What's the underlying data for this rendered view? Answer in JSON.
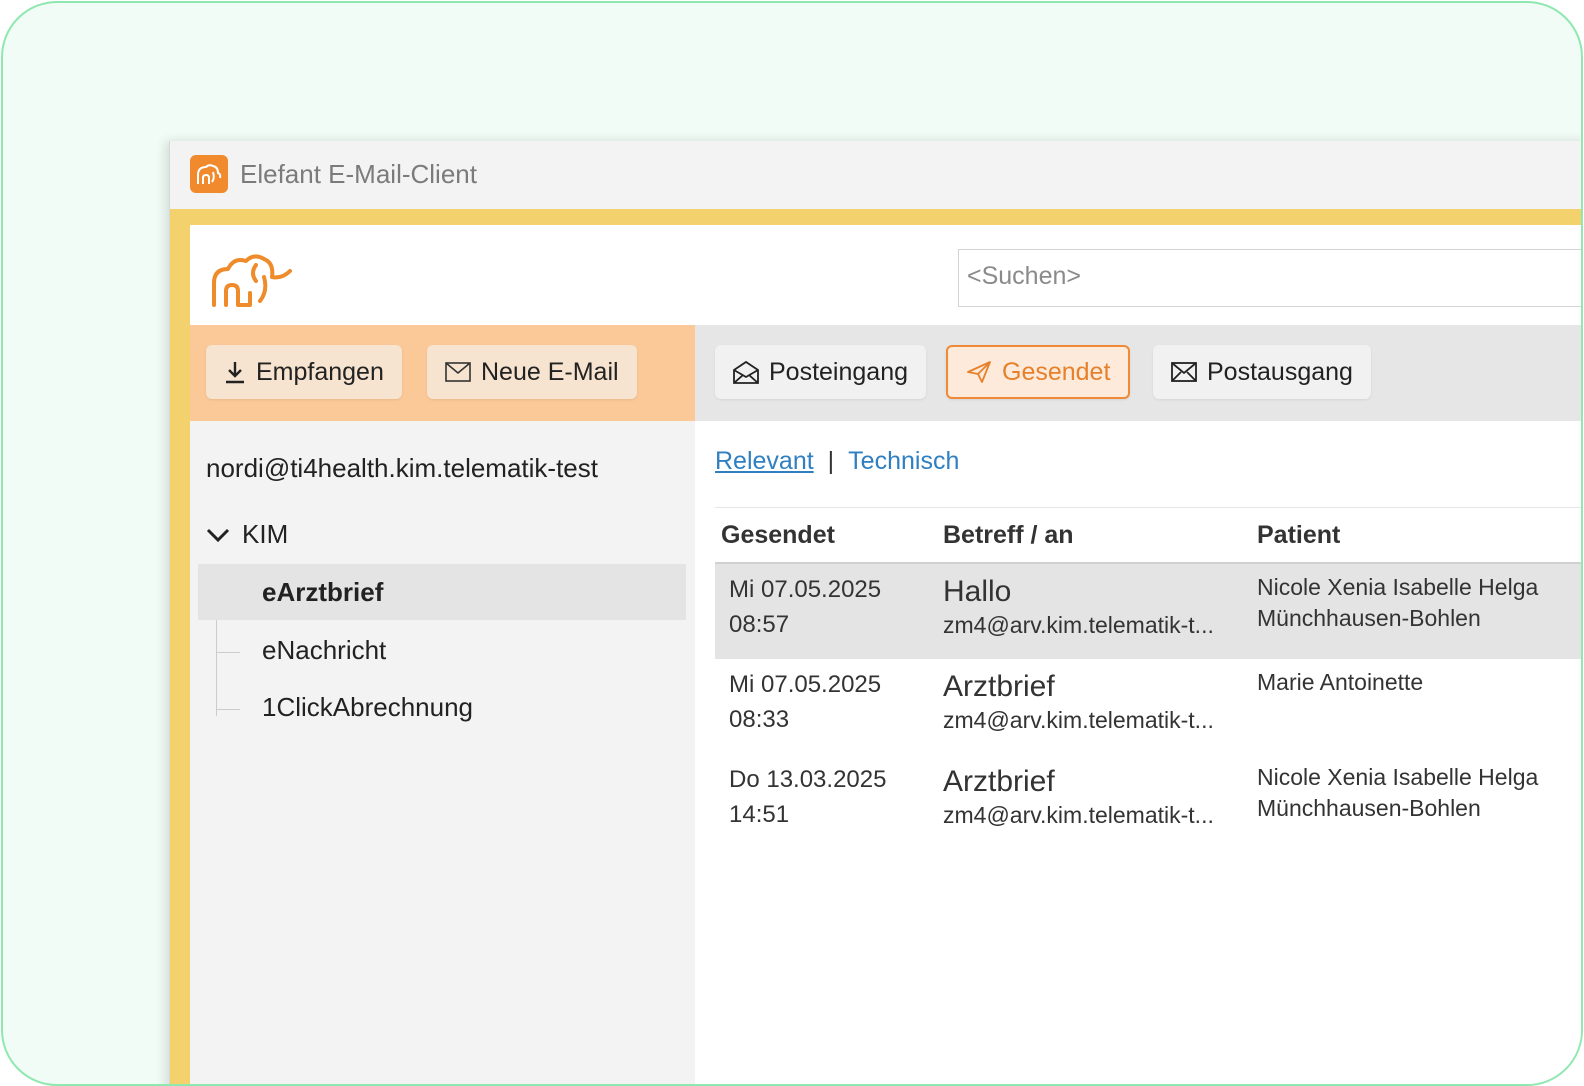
{
  "window": {
    "title": "Elefant E-Mail-Client",
    "app_icon": "elephant-icon",
    "accent_color": "#f08a2c"
  },
  "search": {
    "placeholder": "<Suchen>"
  },
  "toolbar": {
    "receive_label": "Empfangen",
    "new_mail_label": "Neue E-Mail",
    "inbox_label": "Posteingang",
    "sent_label": "Gesendet",
    "outbox_label": "Postausgang"
  },
  "sidebar": {
    "account": "nordi@ti4health.kim.telematik-test",
    "group": "KIM",
    "folders": [
      "eArztbrief",
      "eNachricht",
      "1ClickAbrechnung"
    ]
  },
  "filters": {
    "relevant": "Relevant",
    "separator": "|",
    "technical": "Technisch"
  },
  "table": {
    "headers": {
      "sent": "Gesendet",
      "subject": "Betreff / an",
      "patient": "Patient"
    },
    "rows": [
      {
        "date": "Mi 07.05.2025",
        "time": "08:57",
        "subject": "Hallo",
        "to": "zm4@arv.kim.telematik-t...",
        "patient_line1": "Nicole Xenia Isabelle Helga",
        "patient_line2": "Münchhausen-Bohlen"
      },
      {
        "date": "Mi 07.05.2025",
        "time": "08:33",
        "subject": "Arztbrief",
        "to": "zm4@arv.kim.telematik-t...",
        "patient_line1": "Marie Antoinette",
        "patient_line2": ""
      },
      {
        "date": "Do 13.03.2025",
        "time": "14:51",
        "subject": "Arztbrief",
        "to": "zm4@arv.kim.telematik-t...",
        "patient_line1": "Nicole Xenia Isabelle Helga",
        "patient_line2": "Münchhausen-Bohlen"
      }
    ]
  }
}
